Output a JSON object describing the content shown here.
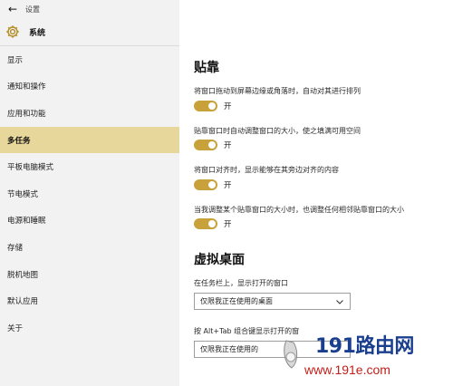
{
  "window": {
    "title": "设置"
  },
  "app_header": {
    "label": "系统"
  },
  "sidebar": {
    "items": [
      {
        "label": "显示"
      },
      {
        "label": "通知和操作"
      },
      {
        "label": "应用和功能"
      },
      {
        "label": "多任务",
        "active": true
      },
      {
        "label": "平板电脑模式"
      },
      {
        "label": "节电模式"
      },
      {
        "label": "电源和睡眠"
      },
      {
        "label": "存储"
      },
      {
        "label": "脱机地图"
      },
      {
        "label": "默认应用"
      },
      {
        "label": "关于"
      }
    ]
  },
  "snap": {
    "title": "贴靠",
    "settings": [
      {
        "desc": "将窗口拖动到屏幕边缘或角落时，自动对其进行排列",
        "state": "开",
        "on": true
      },
      {
        "desc": "贴靠窗口时自动调整窗口的大小，使之填满可用空间",
        "state": "开",
        "on": true
      },
      {
        "desc": "将窗口对齐时，显示能够在其旁边对齐的内容",
        "state": "开",
        "on": true
      },
      {
        "desc": "当我调整某个贴靠窗口的大小时，也调整任何相邻贴靠窗口的大小",
        "state": "开",
        "on": true
      }
    ]
  },
  "virtual_desktop": {
    "title": "虚拟桌面",
    "taskbar_desc": "在任务栏上，显示打开的窗口",
    "taskbar_value": "仅限我正在使用的桌面",
    "alttab_desc": "按 Alt+Tab 组合键显示打开的窗",
    "alttab_value": "仅限我正在使用的"
  },
  "watermark": {
    "title": "191路由网",
    "url": "www.191e.com"
  },
  "colors": {
    "accent": "#c9a13a",
    "active_nav": "#e8d79a",
    "watermark_blue": "#1b3f8f",
    "watermark_red": "#c0201a"
  },
  "icons": {
    "back": "back-arrow-icon",
    "system": "gear-icon",
    "dropdown": "chevron-down-icon"
  }
}
